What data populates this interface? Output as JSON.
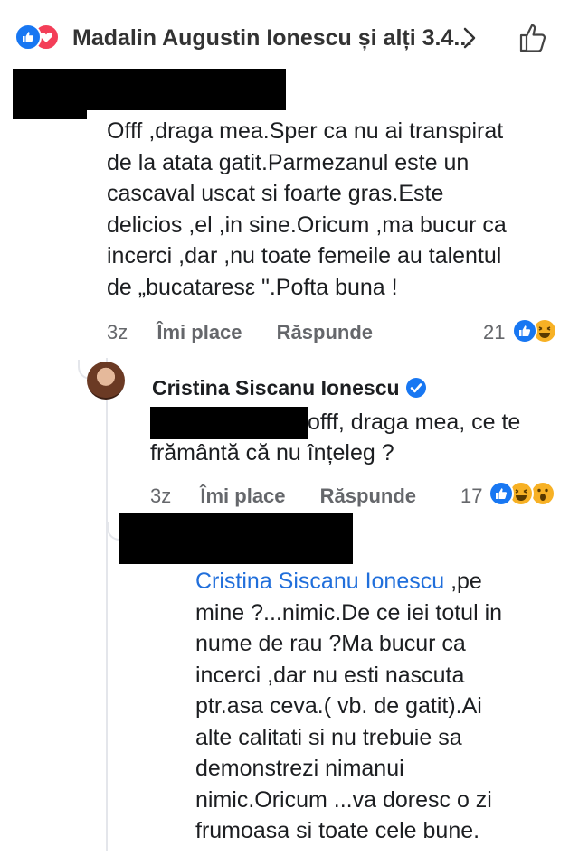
{
  "header": {
    "title": "Madalin Augustin Ionescu și alți 3.4...",
    "colors": {
      "like": "#1877f2",
      "love": "#f33e58"
    }
  },
  "comment1": {
    "lines": [
      "Offf ,draga mea.Sper ca nu ai transpirat",
      "de la atata gatit.Parmezanul este un",
      "cascaval uscat si foarte gras.Este",
      "delicios ,el ,in sine.Oricum ,ma bucur ca",
      "incerci ,dar ,nu toate femeile au talentul",
      "de „bucataresε \".Pofta buna !"
    ],
    "time": "3z",
    "like_label": "Îmi place",
    "reply_label": "Răspunde",
    "reaction_count": "21",
    "reactions": [
      "like-icon",
      "haha-icon"
    ]
  },
  "reply1": {
    "author": "Cristina Siscanu Ionescu",
    "text_line1": "offf, draga mea, ce te",
    "text_line2": "frământă că nu înțeleg ?",
    "time": "3z",
    "like_label": "Îmi place",
    "reply_label": "Răspunde",
    "reaction_count": "17",
    "reactions": [
      "like-icon",
      "haha-icon",
      "wow-icon"
    ]
  },
  "reply2": {
    "mention": "Cristina Siscanu Ionescu",
    "first_line_rest": " ,pe",
    "lines": [
      "mine ?...nimic.De ce iei totul in",
      "nume de rau ?Ma bucur ca",
      "incerci ,dar nu esti nascuta",
      "ptr.asa ceva.( vb. de gatit).Ai",
      "alte calitati si nu trebuie sa",
      "demonstrezi nimanui",
      "nimic.Oricum ...va doresc o zi",
      "frumoasa si toate cele bune."
    ]
  }
}
